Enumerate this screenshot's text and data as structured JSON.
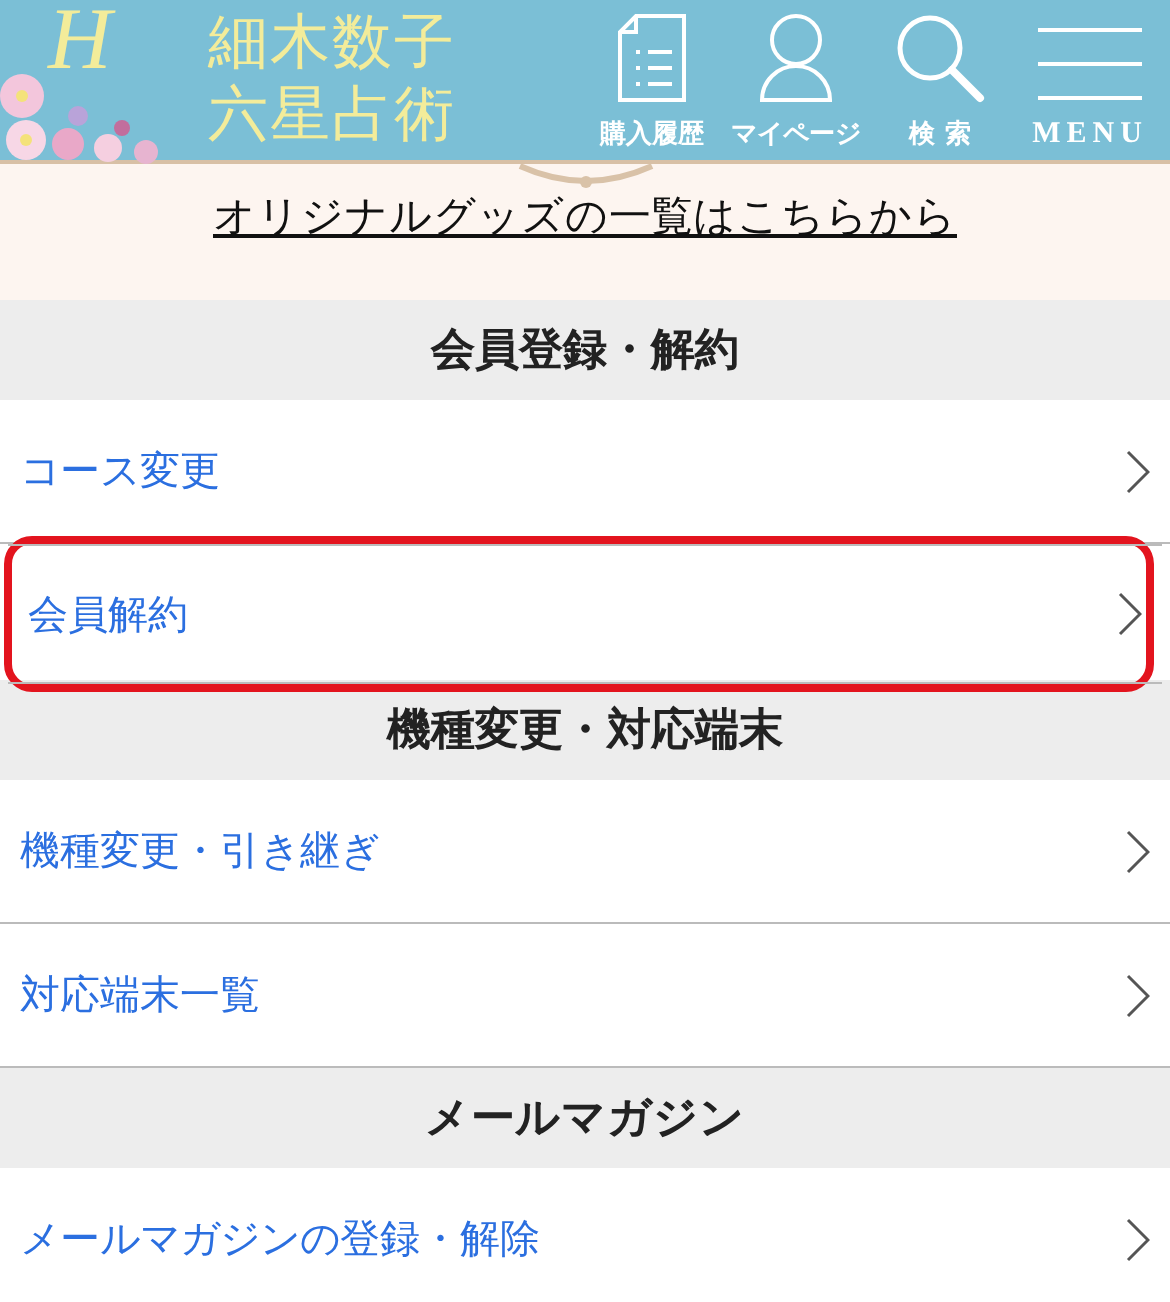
{
  "header": {
    "logo_letter": "H",
    "title_lines": [
      "細木数子",
      "六星占術"
    ],
    "nav": [
      {
        "kind": "document",
        "label": "購入履歴"
      },
      {
        "kind": "person",
        "label": "マイページ"
      },
      {
        "kind": "search",
        "label": "検 索"
      },
      {
        "kind": "menu",
        "label": "MENU"
      }
    ]
  },
  "banner": {
    "link": "オリジナルグッズの一覧はこちらから"
  },
  "sections": [
    {
      "title": "会員登録・解約",
      "items": [
        {
          "label": "コース変更",
          "highlighted": false
        },
        {
          "label": "会員解約",
          "highlighted": true
        }
      ]
    },
    {
      "title": "機種変更・対応端末",
      "items": [
        {
          "label": "機種変更・引き継ぎ",
          "highlighted": false
        },
        {
          "label": "対応端末一覧",
          "highlighted": false
        }
      ]
    },
    {
      "title": "メールマガジン",
      "items": [
        {
          "label": "メールマガジンの登録・解除",
          "highlighted": false
        }
      ]
    }
  ]
}
